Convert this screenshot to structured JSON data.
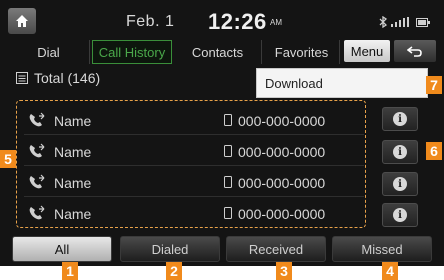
{
  "statusbar": {
    "date": "Feb. 1",
    "time": "12:26",
    "ampm": "AM",
    "icons": [
      "bluetooth-icon",
      "signal-icon",
      "battery-icon"
    ]
  },
  "tabs": [
    {
      "label": "Dial"
    },
    {
      "label": "Call History",
      "active": true
    },
    {
      "label": "Contacts"
    },
    {
      "label": "Favorites"
    }
  ],
  "menu_label": "Menu",
  "total_label": "Total (146)",
  "dropdown": {
    "item": "Download"
  },
  "calls": [
    {
      "name": "Name",
      "number": "000-000-0000"
    },
    {
      "name": "Name",
      "number": "000-000-0000"
    },
    {
      "name": "Name",
      "number": "000-000-0000"
    },
    {
      "name": "Name",
      "number": "000-000-0000"
    }
  ],
  "filters": [
    {
      "label": "All",
      "selected": true
    },
    {
      "label": "Dialed"
    },
    {
      "label": "Received"
    },
    {
      "label": "Missed"
    }
  ],
  "callouts": [
    "1",
    "2",
    "3",
    "4",
    "5",
    "6",
    "7"
  ],
  "colors": {
    "accent_green": "#4aa84a",
    "callout_orange": "#f08a1c",
    "background": "#141414"
  }
}
